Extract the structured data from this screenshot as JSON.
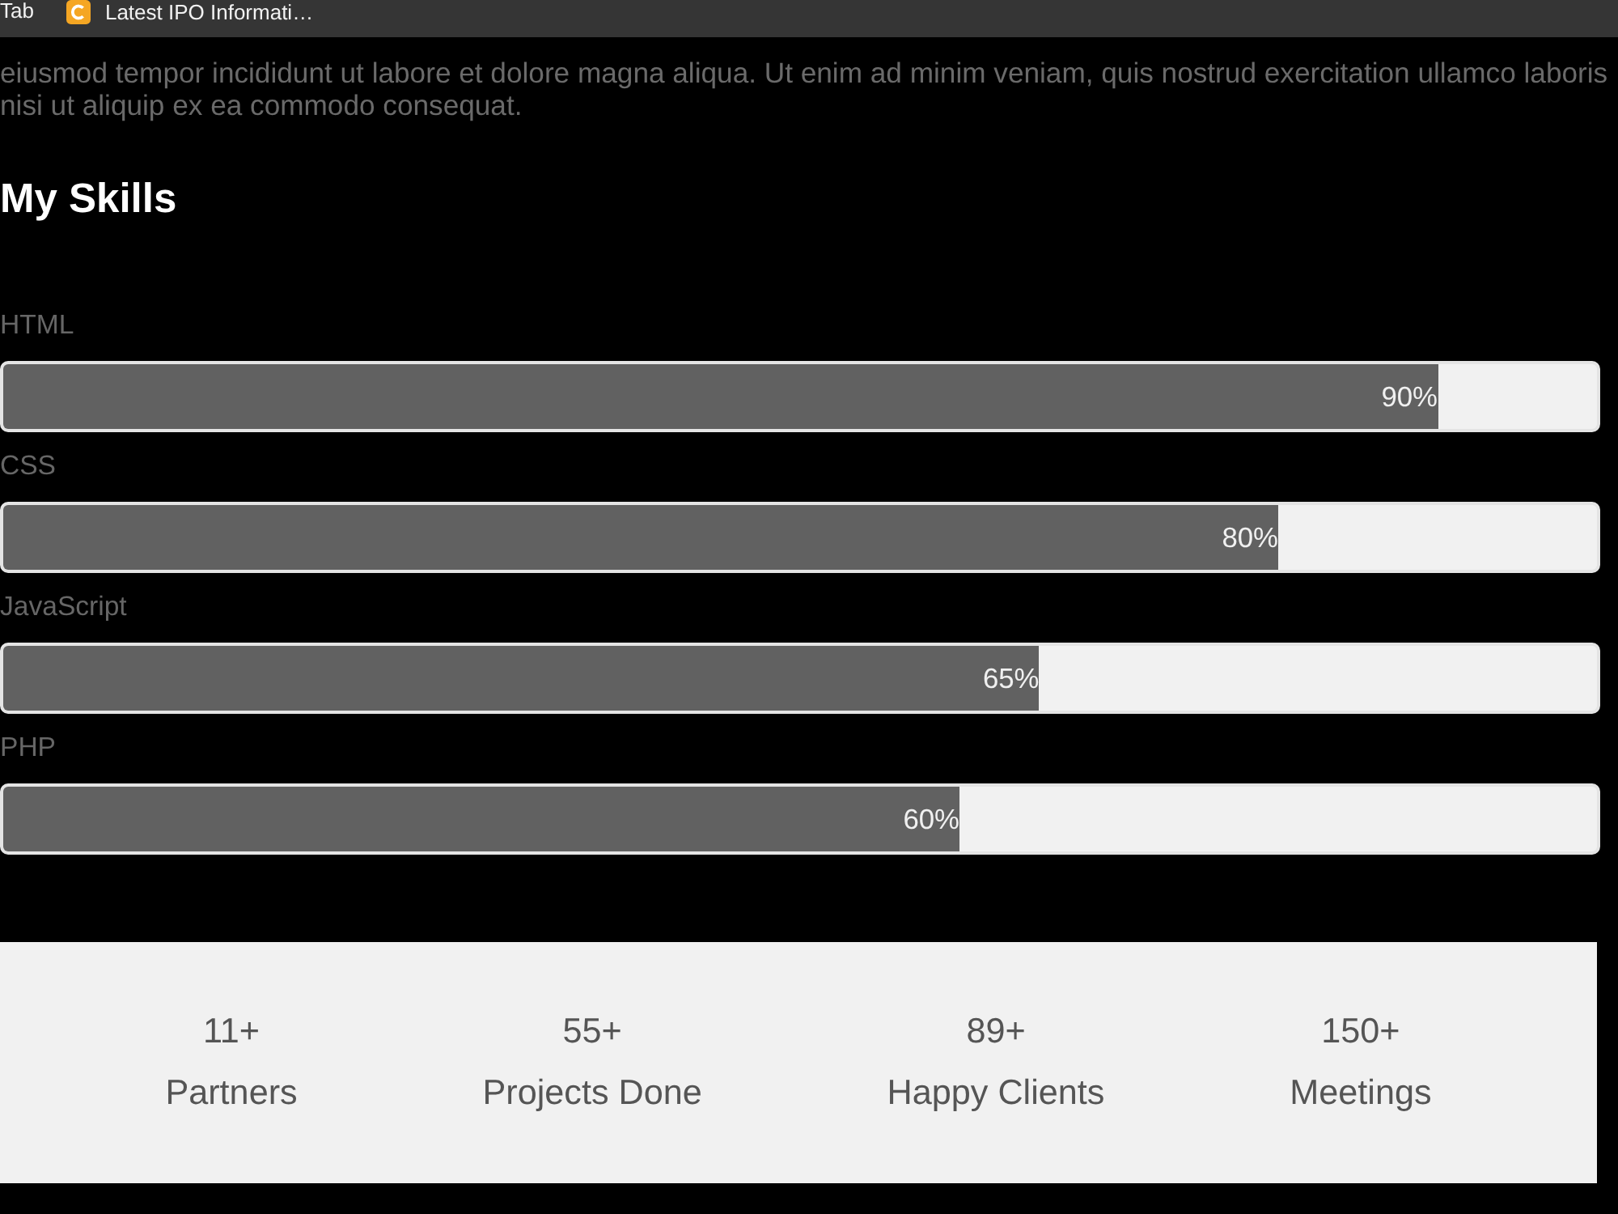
{
  "bookmarks_bar": {
    "items": [
      {
        "label": "Tab",
        "kind": "text"
      },
      {
        "label": "Latest IPO Informati…",
        "kind": "favicon"
      }
    ]
  },
  "intro_text": "eiusmod tempor incididunt ut labore et dolore magna aliqua. Ut enim ad minim veniam, quis nostrud exercitation ullamco laboris nisi ut aliquip ex ea commodo consequat.",
  "skills": {
    "title": "My Skills",
    "items": [
      {
        "name": "HTML",
        "level": 0.9,
        "reading": "90%"
      },
      {
        "name": "CSS",
        "level": 0.8,
        "reading": "80%"
      },
      {
        "name": "JavaScript",
        "level": 0.65,
        "reading": "65%"
      },
      {
        "name": "PHP",
        "level": 0.6,
        "reading": "60%"
      }
    ]
  },
  "stats": [
    {
      "value": "11+",
      "label": "Partners"
    },
    {
      "value": "55+",
      "label": "Projects Done"
    },
    {
      "value": "89+",
      "label": "Happy Clients"
    },
    {
      "value": "150+",
      "label": "Meetings"
    }
  ]
}
